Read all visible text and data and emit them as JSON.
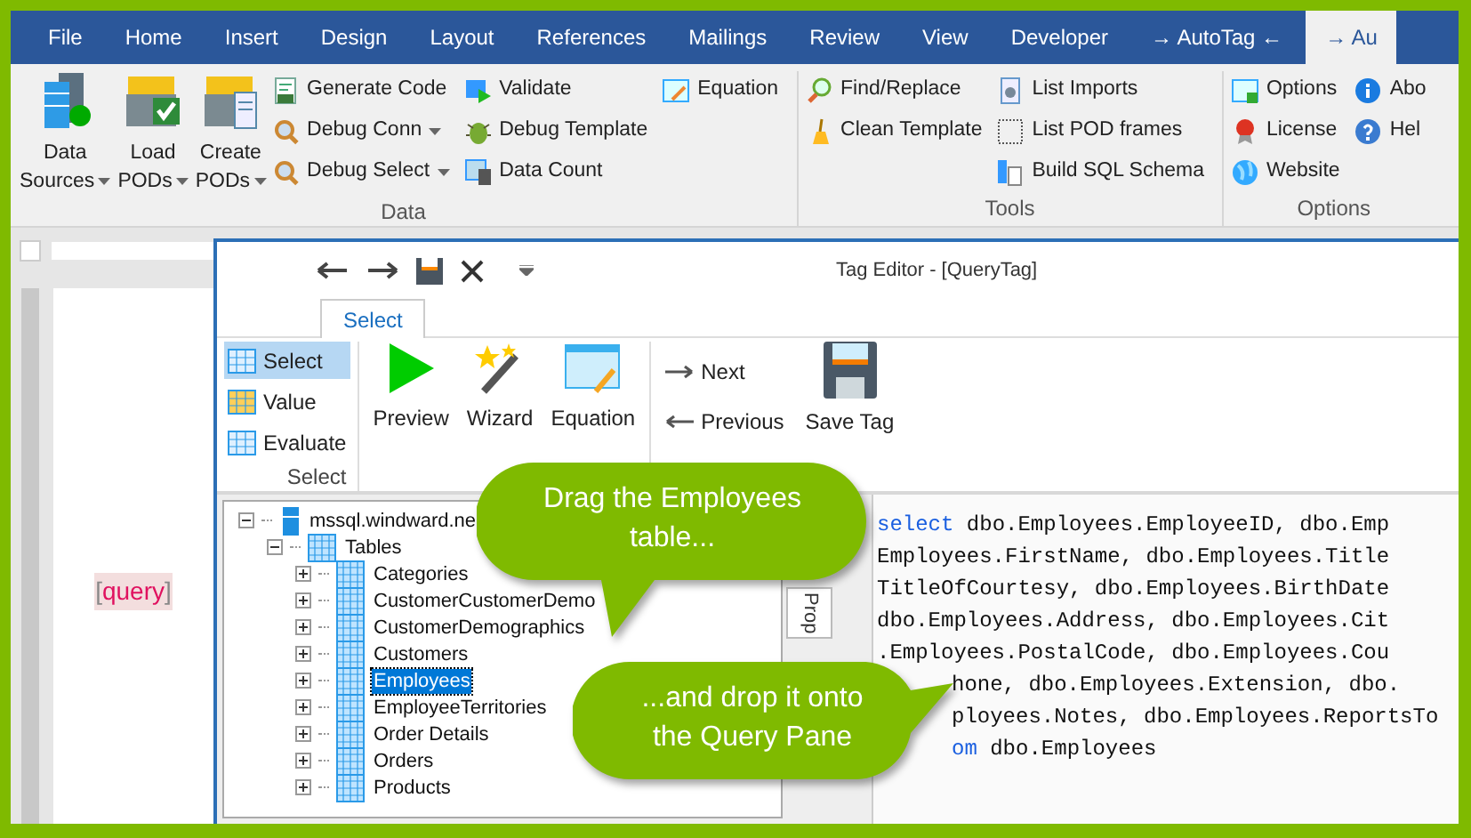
{
  "menu_tabs": [
    {
      "label": "File",
      "selected": false
    },
    {
      "label": "Home",
      "selected": false
    },
    {
      "label": "Insert",
      "selected": false
    },
    {
      "label": "Design",
      "selected": false
    },
    {
      "label": "Layout",
      "selected": false
    },
    {
      "label": "References",
      "selected": false
    },
    {
      "label": "Mailings",
      "selected": false
    },
    {
      "label": "Review",
      "selected": false
    },
    {
      "label": "View",
      "selected": false
    },
    {
      "label": "Developer",
      "selected": false
    },
    {
      "label": "→ AutoTag ←",
      "selected": false
    },
    {
      "label": "→ Au",
      "selected": true
    }
  ],
  "ribbon_groups": [
    {
      "label": "Data",
      "large": [
        {
          "line1": "Data",
          "line2": "Sources",
          "dropdown": true
        },
        {
          "line1": "Load",
          "line2": "PODs",
          "dropdown": true
        },
        {
          "line1": "Create",
          "line2": "PODs",
          "dropdown": true
        }
      ],
      "columns": [
        [
          {
            "label": "Generate Code"
          },
          {
            "label": "Debug Conn",
            "dropdown": true
          },
          {
            "label": "Debug Select",
            "dropdown": true
          }
        ],
        [
          {
            "label": "Validate"
          },
          {
            "label": "Debug Template"
          },
          {
            "label": "Data Count"
          }
        ],
        [
          {
            "label": "Equation"
          }
        ]
      ]
    },
    {
      "label": "Tools",
      "columns": [
        [
          {
            "label": "Find/Replace"
          },
          {
            "label": "Clean Template"
          }
        ],
        [
          {
            "label": "List Imports"
          },
          {
            "label": "List POD frames"
          },
          {
            "label": "Build SQL Schema"
          }
        ]
      ]
    },
    {
      "label": "Options",
      "columns": [
        [
          {
            "label": "Options"
          },
          {
            "label": "License"
          },
          {
            "label": "Website"
          }
        ],
        [
          {
            "label": "Abo"
          },
          {
            "label": "Hel"
          }
        ]
      ]
    }
  ],
  "document": {
    "open_bracket": "[",
    "field": "query",
    "close_bracket": "]"
  },
  "editor": {
    "title": "Tag Editor - [QueryTag]",
    "tabs": [
      {
        "label": "Select",
        "selected": true
      }
    ],
    "tag_types": [
      {
        "label": "Select",
        "selected": true
      },
      {
        "label": "Value",
        "selected": false
      },
      {
        "label": "Evaluate",
        "selected": false
      }
    ],
    "tag_group_label": "Select",
    "actions": [
      {
        "label": "Preview"
      },
      {
        "label": "Wizard"
      },
      {
        "label": "Equation"
      }
    ],
    "nav": [
      {
        "label": "Next"
      },
      {
        "label": "Previous"
      }
    ],
    "save": {
      "label": "Save Tag"
    },
    "tree": [
      {
        "label": "mssql.windward.ne",
        "expanded": true,
        "selected": false,
        "children": [
          {
            "label": "Tables",
            "expanded": true,
            "selected": false,
            "children": [
              {
                "label": "Categories",
                "expanded": false,
                "selected": false
              },
              {
                "label": "CustomerCustomerDemo",
                "expanded": false,
                "selected": false
              },
              {
                "label": "CustomerDemographics",
                "expanded": false,
                "selected": false
              },
              {
                "label": "Customers",
                "expanded": false,
                "selected": false
              },
              {
                "label": "Employees",
                "expanded": false,
                "selected": true
              },
              {
                "label": "EmployeeTerritories",
                "expanded": false,
                "selected": false
              },
              {
                "label": "Order Details",
                "expanded": false,
                "selected": false
              },
              {
                "label": "Orders",
                "expanded": false,
                "selected": false
              },
              {
                "label": "Products",
                "expanded": false,
                "selected": false
              }
            ]
          }
        ]
      }
    ],
    "side_tab": "Prop",
    "query_lines": [
      {
        "keyword": "select",
        "text": " dbo.Employees.EmployeeID, dbo.Emp"
      },
      {
        "text": "Employees.FirstName, dbo.Employees.Title"
      },
      {
        "text": "TitleOfCourtesy, dbo.Employees.BirthDate"
      },
      {
        "text": "dbo.Employees.Address, dbo.Employees.Cit"
      },
      {
        "text": ".Employees.PostalCode, dbo.Employees.Cou"
      },
      {
        "text": "hone, dbo.Employees.Extension, dbo.",
        "covered": true
      },
      {
        "text": "ployees.Notes, dbo.Employees.ReportsTo",
        "covered": true
      },
      {
        "keyword": "om",
        "text": " dbo.Employees",
        "covered": true
      }
    ]
  },
  "callouts": [
    {
      "text": "Drag the Employees table..."
    },
    {
      "text": "...and drop it onto the Query Pane"
    }
  ]
}
